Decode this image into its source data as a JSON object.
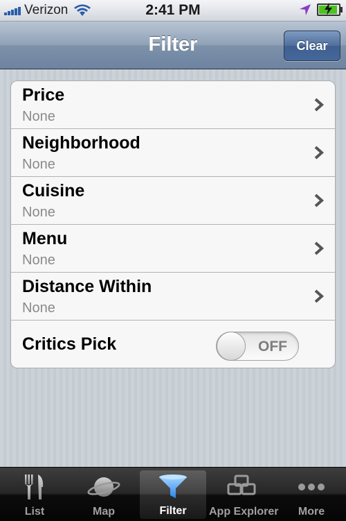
{
  "status_bar": {
    "carrier": "Verizon",
    "time": "2:41 PM"
  },
  "nav": {
    "title": "Filter",
    "clear_label": "Clear"
  },
  "filters": [
    {
      "title": "Price",
      "value": "None"
    },
    {
      "title": "Neighborhood",
      "value": "None"
    },
    {
      "title": "Cuisine",
      "value": "None"
    },
    {
      "title": "Menu",
      "value": "None"
    },
    {
      "title": "Distance Within",
      "value": "None"
    }
  ],
  "critics_pick": {
    "title": "Critics Pick",
    "state_label": "OFF"
  },
  "tabs": [
    {
      "label": "List",
      "icon": "fork-knife-icon"
    },
    {
      "label": "Map",
      "icon": "planet-icon"
    },
    {
      "label": "Filter",
      "icon": "funnel-icon",
      "active": true
    },
    {
      "label": "App Explorer",
      "icon": "windows-icon"
    },
    {
      "label": "More",
      "icon": "more-dots-icon"
    }
  ],
  "colors": {
    "nav_bar": "#7d91a9",
    "clear_button": "#46679a",
    "tab_active_icon": "#3d9bf0",
    "battery": "#4cc21f"
  }
}
